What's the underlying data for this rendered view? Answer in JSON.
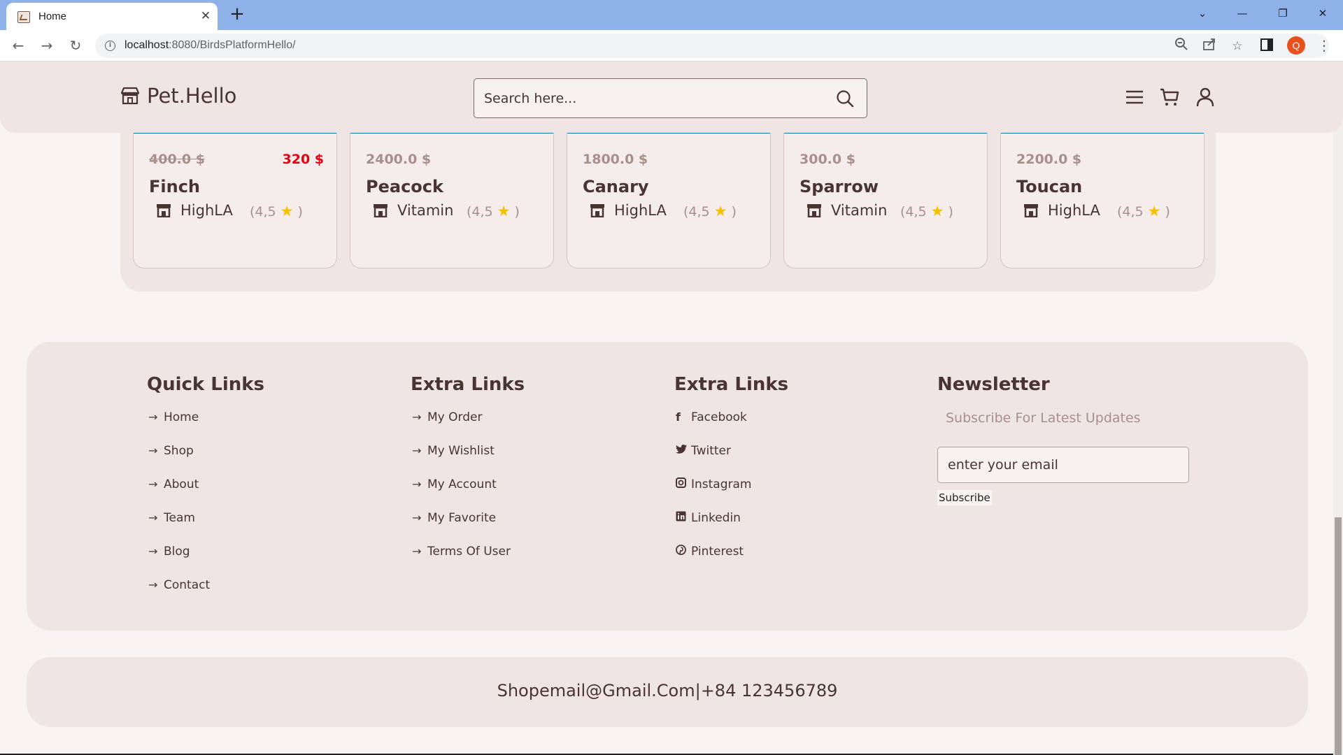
{
  "browser": {
    "tab_title": "Home",
    "tab_close": "✕",
    "new_tab": "+",
    "url_host": "localhost",
    "url_path": ":8080/BirdsPlatformHello/",
    "profile_initial": "Q"
  },
  "header": {
    "logo_text": "Pet.Hello",
    "search_placeholder": "Search here..."
  },
  "products": [
    {
      "price": "400.0 $",
      "sale_price": "320 $",
      "name": "Finch",
      "shop": "HighLA",
      "rating_open": "(4,5",
      "rating_close": ")"
    },
    {
      "price": "2400.0 $",
      "sale_price": "",
      "name": "Peacock",
      "shop": "Vitamin",
      "rating_open": "(4,5",
      "rating_close": ")"
    },
    {
      "price": "1800.0 $",
      "sale_price": "",
      "name": "Canary",
      "shop": "HighLA",
      "rating_open": "(4,5",
      "rating_close": ")"
    },
    {
      "price": "300.0 $",
      "sale_price": "",
      "name": "Sparrow",
      "shop": "Vitamin",
      "rating_open": "(4,5",
      "rating_close": ")"
    },
    {
      "price": "2200.0 $",
      "sale_price": "",
      "name": "Toucan",
      "shop": "HighLA",
      "rating_open": "(4,5",
      "rating_close": ")"
    }
  ],
  "footer": {
    "quick_links": {
      "title": "Quick Links",
      "items": [
        "Home",
        "Shop",
        "About",
        "Team",
        "Blog",
        "Contact"
      ]
    },
    "extra_links_1": {
      "title": "Extra Links",
      "items": [
        "My Order",
        "My Wishlist",
        "My Account",
        "My Favorite",
        "Terms Of User"
      ]
    },
    "extra_links_2": {
      "title": "Extra Links",
      "items": [
        "Facebook",
        "Twitter",
        "Instagram",
        "Linkedin",
        "Pinterest"
      ]
    },
    "newsletter": {
      "title": "Newsletter",
      "subtitle": "Subscribe For Latest Updates",
      "placeholder": "enter your email",
      "button": "Subscribe"
    },
    "contact": "Shopemail@Gmail.Com|+84 123456789"
  },
  "colors": {
    "accent_sale": "#e60012",
    "text_brown": "#4a3431",
    "panel": "#efe6e3",
    "star": "#f5c000"
  }
}
